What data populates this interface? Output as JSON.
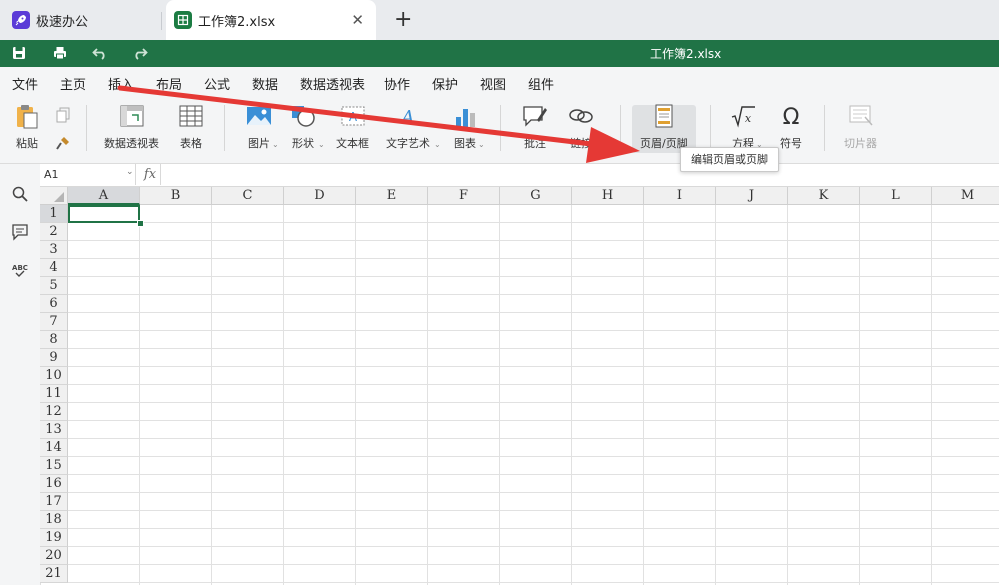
{
  "browser": {
    "tabs": [
      {
        "label": "极速办公",
        "icon": "rocket-icon"
      },
      {
        "label": "工作簿2.xlsx",
        "icon": "spreadsheet-icon"
      }
    ],
    "close_glyph": "✕",
    "new_tab_glyph": "+"
  },
  "titlebar": {
    "title": "工作簿2.xlsx",
    "color": "#207346"
  },
  "menu": {
    "items": [
      "文件",
      "主页",
      "插入",
      "布局",
      "公式",
      "数据",
      "数据透视表",
      "协作",
      "保护",
      "视图",
      "组件"
    ],
    "active": "插入"
  },
  "ribbon": {
    "paste": "粘贴",
    "pivot_table": "数据透视表",
    "table": "表格",
    "picture": "图片",
    "shape": "形状",
    "textbox": "文本框",
    "wordart": "文字艺术",
    "chart": "图表",
    "comment": "批注",
    "link": "链接",
    "header_footer": "页眉/页脚",
    "equation": "方程",
    "symbol": "符号",
    "slicer": "切片器"
  },
  "tooltip": "编辑页眉或页脚",
  "formula_bar": {
    "name_box": "A1",
    "fx": "fx",
    "value": ""
  },
  "sheet": {
    "columns": [
      "A",
      "B",
      "C",
      "D",
      "E",
      "F",
      "G",
      "H",
      "I",
      "J",
      "K",
      "L",
      "M"
    ],
    "rows": [
      "1",
      "2",
      "3",
      "4",
      "5",
      "6",
      "7",
      "8",
      "9",
      "10",
      "11",
      "12",
      "13",
      "14",
      "15",
      "16",
      "17",
      "18",
      "19",
      "20",
      "21"
    ],
    "selected_cell": "A1"
  },
  "annotation": {
    "color": "#e53935"
  }
}
